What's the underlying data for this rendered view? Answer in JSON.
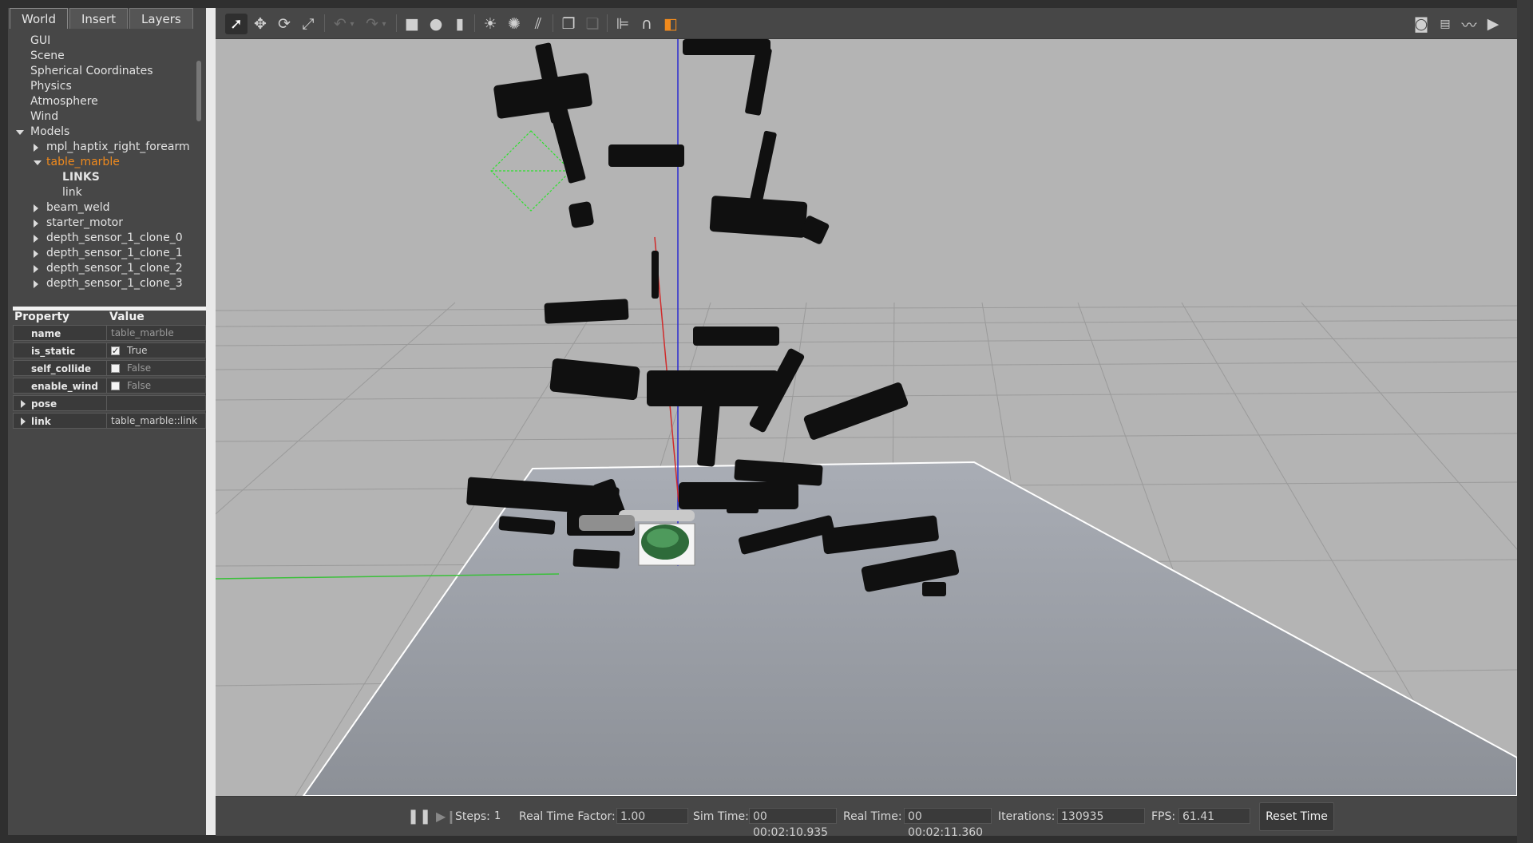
{
  "left_panel": {
    "tabs": [
      {
        "label": "World",
        "active": true
      },
      {
        "label": "Insert",
        "active": false
      },
      {
        "label": "Layers",
        "active": false
      }
    ],
    "tree": {
      "gui": "GUI",
      "scene": "Scene",
      "spherical": "Spherical Coordinates",
      "physics": "Physics",
      "atmosphere": "Atmosphere",
      "wind": "Wind",
      "models": "Models",
      "m0": "mpl_haptix_right_forearm",
      "m1": "table_marble",
      "m1_links": "LINKS",
      "m1_link": "link",
      "m2": "beam_weld",
      "m3": "starter_motor",
      "m4": "depth_sensor_1_clone_0",
      "m5": "depth_sensor_1_clone_1",
      "m6": "depth_sensor_1_clone_2",
      "m7": "depth_sensor_1_clone_3"
    },
    "properties": {
      "header_property": "Property",
      "header_value": "Value",
      "name_key": "name",
      "name_val": "table_marble",
      "static_key": "is_static",
      "static_val": "True",
      "collide_key": "self_collide",
      "collide_val": "False",
      "wind_key": "enable_wind",
      "wind_val": "False",
      "pose_key": "pose",
      "link_key": "link",
      "link_val": "table_marble::link"
    }
  },
  "toolbar": {
    "icons": [
      "select-icon",
      "translate-icon",
      "rotate-icon",
      "scale-icon",
      "undo-icon",
      "redo-icon",
      "box-icon",
      "sphere-icon",
      "cylinder-icon",
      "point-light-icon",
      "spot-light-icon",
      "directional-light-icon",
      "copy-icon",
      "paste-icon",
      "align-icon",
      "snap-icon",
      "change-view-icon",
      "screenshot-icon",
      "log-icon",
      "plot-icon",
      "video-icon"
    ]
  },
  "bottom_bar": {
    "steps_label": "Steps:",
    "steps_value": "1",
    "rtf_label": "Real Time Factor:",
    "rtf_value": "1.00",
    "sim_label": "Sim Time:",
    "sim_value": "00 00:02:10.935",
    "real_label": "Real Time:",
    "real_value": "00 00:02:11.360",
    "iter_label": "Iterations:",
    "iter_value": "130935",
    "fps_label": "FPS:",
    "fps_value": "61.41",
    "reset_label": "Reset Time"
  },
  "colors": {
    "selected_model": "#f08a1d",
    "sky": "#b4b4b4",
    "table": "#9fa4ac"
  }
}
